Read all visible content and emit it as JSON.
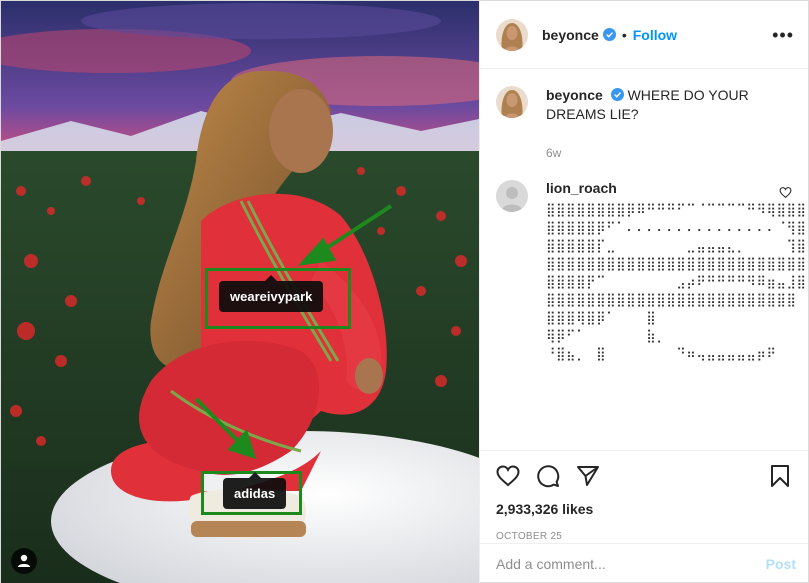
{
  "post": {
    "author": "beyonce",
    "follow_label": "Follow",
    "dot": "•",
    "more": "•••"
  },
  "photo": {
    "tags": [
      {
        "label": "weareivypark"
      },
      {
        "label": "adidas"
      }
    ]
  },
  "caption": {
    "author": "beyonce",
    "text": "WHERE DO YOUR DREAMS LIE?",
    "time": "6w"
  },
  "comments": [
    {
      "author": "lion_roach",
      "text": "⣿⣿⣿⣿⣿⣿⣿⣿⡿⠿⠛⠛⠛⠋⠉⠈⠉⠉⠉⠉⠛⠻⢿⣿⣿⣿⣿⣿⣿⣿\n⣿⣿⣿⣿⣿⡿⠋⠁⠄⠄⠄⠄⠄⠄⠄⠄⠄⠄⠄⠄⠄⠄⠄⠈⢻⣿⣿⣿\n⣿⣿⣿⣿⣿⡏⣀⠀⠀⠀⠀⠀⠀⠀⣀⣤⣤⣤⣄⡀⠀⠀⠀⠀⢹⣿⣿\n⣿⣿⣿⣿⣿⣿⣿⣿⣿⣿⣿⣿⣿⣿⣿⣿⣿⣿⣿⣿⣿⣿⣿⣿⣿⣿⣿\n⣿⣿⣿⣿⡟⠉⠀⠀⠀⠀⠀⠀⠀⣠⡴⠟⠛⠛⠛⠛⠻⠿⣶⣤⣸⣿\n⣿⣿⣿⣿⣿⣿⣿⣿⣿⣿⣿⣿⣿⣿⣿⣿⣿⣿⣿⣿⣿⣿⣿⣿⣿\n⣿⣿⣿⢿⣿⡿⠁⠀⠀⠀⣿⠀⠀⠀⠀⠀⠀⠀⠀⠀⠀⠀⠀⠀⠀⠀⠂\n⢿⡿⠋⠁⠀⠀⠀⠀⠀⠀⣷⡀\n⠘⣿⣦⡀⠀⣿⠀⠀⠀⠀⠀⠀⠀⠙⠶⢤⣤⣤⣤⣤⣤⡶⠟"
    }
  ],
  "actions": {
    "likes": "2,933,326 likes",
    "date": "OCTOBER 25"
  },
  "add_comment": {
    "placeholder": "Add a comment...",
    "post_label": "Post"
  },
  "colors": {
    "accent": "#0095f6",
    "tag_box": "#1e8a1e",
    "verified": "#3897f0",
    "dress": "#e0303a"
  },
  "icons": [
    "verified-badge-icon",
    "more-options-icon",
    "heart-icon",
    "comment-icon",
    "share-icon",
    "bookmark-icon",
    "user-tag-icon"
  ]
}
